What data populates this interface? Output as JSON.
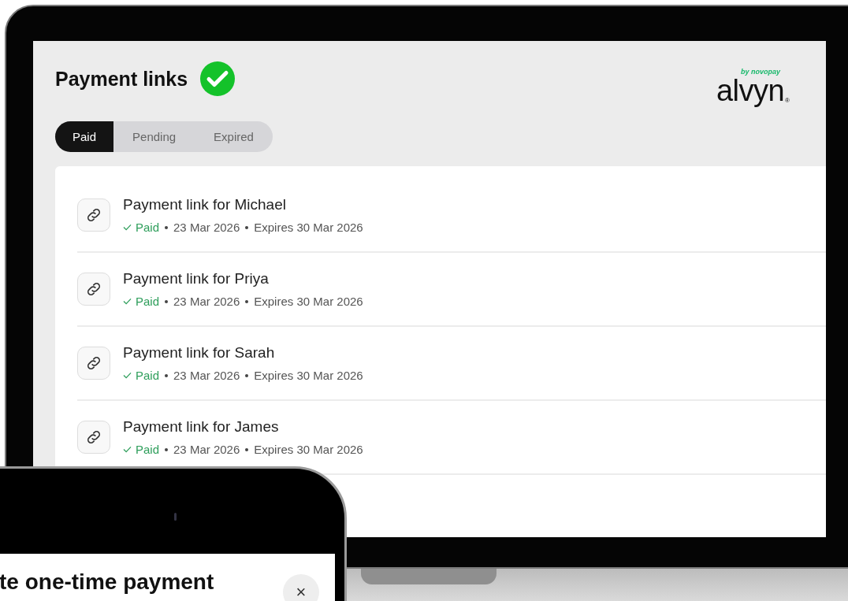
{
  "header": {
    "title": "Payment links",
    "verified": true
  },
  "logo": {
    "wordmark": "alvyn",
    "byline": "by novopay",
    "mark": "®"
  },
  "tabs": [
    {
      "label": "Paid",
      "selected": true
    },
    {
      "label": "Pending",
      "selected": false
    },
    {
      "label": "Expired",
      "selected": false
    }
  ],
  "links": [
    {
      "title": "Payment link for Michael",
      "status": "Paid",
      "paid": true,
      "date": "23 Mar 2026",
      "expires": "Expires 30 Mar 2026"
    },
    {
      "title": "Payment link for Priya",
      "status": "Paid",
      "paid": true,
      "date": "23 Mar 2026",
      "expires": "Expires 30 Mar 2026"
    },
    {
      "title": "Payment link for Sarah",
      "status": "Paid",
      "paid": true,
      "date": "23 Mar 2026",
      "expires": "Expires 30 Mar 2026"
    },
    {
      "title": "Payment link for James",
      "status": "Paid",
      "paid": true,
      "date": "23 Mar 2026",
      "expires": "Expires 30 Mar 2026"
    }
  ],
  "phone_sheet": {
    "title": "te one-time payment",
    "close": "×"
  }
}
